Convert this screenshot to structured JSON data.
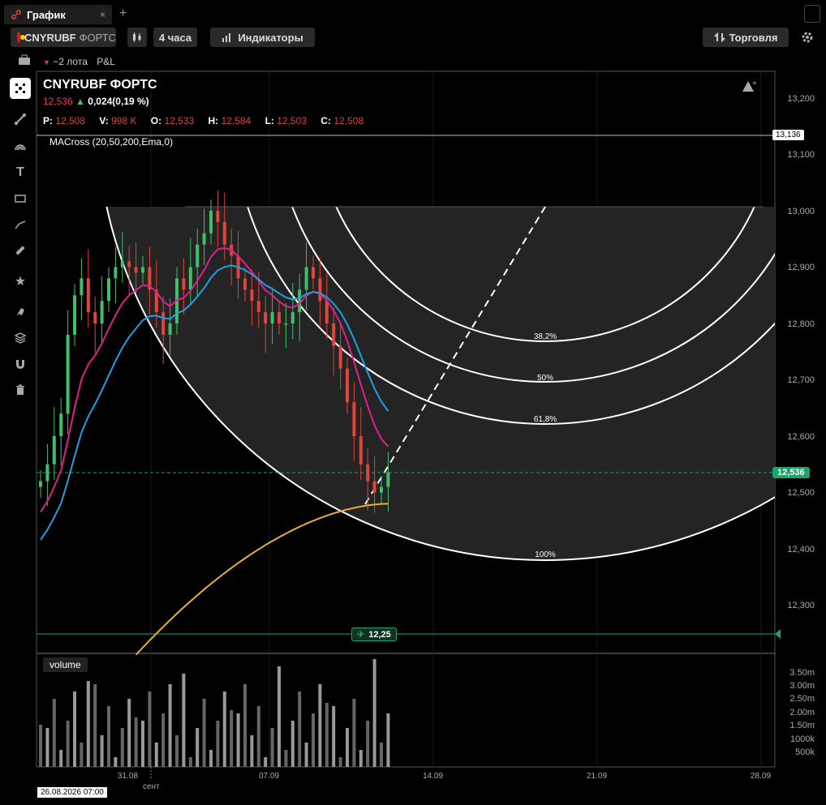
{
  "tab": {
    "title": "График",
    "close": "×",
    "add": "+"
  },
  "toolbar": {
    "symbol": "CNYRUBF",
    "exchange": "ФОРТС",
    "interval": "4 часа",
    "indicators": "Индикаторы",
    "trade": "Торговля"
  },
  "position": {
    "lots": "−2 лота",
    "pnl": "P&L"
  },
  "legend": {
    "title": "CNYRUBF ФОРТС",
    "last": "12,536",
    "change": "0,024(0,19 %)",
    "p_label": "P:",
    "p_val": "12,508",
    "v_label": "V:",
    "v_val": "998 K",
    "o_label": "O:",
    "o_val": "12,533",
    "h_label": "H:",
    "h_val": "12,584",
    "l_label": "L:",
    "l_val": "12,503",
    "c_label": "C:",
    "c_val": "12,508",
    "macross": "MACross (20,50,200,Ema,0)",
    "volume": "volume"
  },
  "price_axis": [
    "13,200",
    "13,100",
    "13,000",
    "12,900",
    "12,800",
    "12,700",
    "12,600",
    "12,500",
    "12,400",
    "12,300"
  ],
  "volume_axis": [
    "3.50m",
    "3.00m",
    "2.50m",
    "2.00m",
    "1.50m",
    "1000k",
    "500k"
  ],
  "levels": {
    "hline_price": "13,136",
    "current_price": "12,536",
    "order_price": "12,25"
  },
  "fib": {
    "l1": "38,2%",
    "l2": "50%",
    "l3": "61,8%",
    "l4": "100%"
  },
  "time_axis": {
    "t1": "31.08",
    "t2": "сент",
    "t3": "07.09",
    "t4": "14.09",
    "t5": "21.09",
    "t6": "28.09",
    "cursor": "26.08.2026 07:00"
  },
  "colors": {
    "up": "#3fbf6a",
    "down": "#e0453c",
    "ema20": "#e0208a",
    "ema50": "#1ea0e0",
    "ema200": "#e8b030",
    "accent": "#1fa36a"
  },
  "chart_data": {
    "type": "candlestick",
    "title": "CNYRUBF ФОРТС",
    "ylim": [
      12.2,
      13.25
    ],
    "closes": [
      12.52,
      12.55,
      12.6,
      12.64,
      12.78,
      12.85,
      12.88,
      12.82,
      12.8,
      12.84,
      12.88,
      12.9,
      12.91,
      12.9,
      12.89,
      12.9,
      12.86,
      12.82,
      12.78,
      12.8,
      12.88,
      12.86,
      12.9,
      12.94,
      12.96,
      13.0,
      12.98,
      12.94,
      12.92,
      12.88,
      12.86,
      12.84,
      12.82,
      12.8,
      12.82,
      12.8,
      12.8,
      12.82,
      12.86,
      12.9,
      12.88,
      12.84,
      12.8,
      12.76,
      12.72,
      12.66,
      12.6,
      12.55,
      12.52,
      12.5,
      12.51,
      12.536
    ]
  }
}
